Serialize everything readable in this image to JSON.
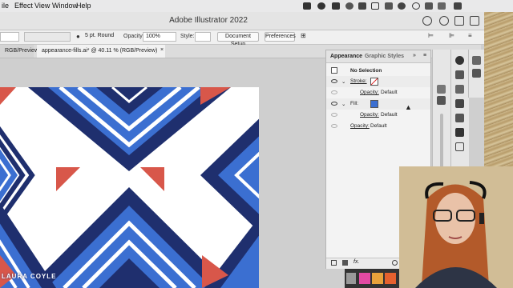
{
  "menubar": {
    "items": [
      "ile",
      "Effect",
      "View",
      "Window",
      "Help"
    ]
  },
  "titlebar": {
    "title": "Adobe Illustrator 2022"
  },
  "controlbar": {
    "stroke_profile": "5 pt. Round",
    "opacity_label": "Opacity:",
    "opacity_value": "100%",
    "style_label": "Style:",
    "document_setup": "Document Setup",
    "preferences": "Preferences"
  },
  "tabs": [
    {
      "label": "RGB/Preview)"
    },
    {
      "label": "appearance-fills.ai* @ 40.11 % (RGB/Preview)"
    }
  ],
  "appearance_panel": {
    "tabs": [
      "Appearance",
      "Graphic Styles"
    ],
    "selection": "No Selection",
    "rows": [
      {
        "label": "Stroke:",
        "type": "stroke"
      },
      {
        "label": "Opacity:",
        "value": "Default",
        "type": "opacity"
      },
      {
        "label": "Fill:",
        "type": "fill"
      },
      {
        "label": "Opacity:",
        "value": "Default",
        "type": "opacity"
      },
      {
        "label": "Opacity:",
        "value": "Default",
        "type": "opacity-root"
      }
    ],
    "fx_label": "fx."
  },
  "watermark": {
    "text": "LAURA COYLE"
  },
  "colors": {
    "navy": "#1f2f6e",
    "blue": "#3b6fd1",
    "coral": "#d8574a",
    "panel_bg": "#f3f3f3"
  }
}
